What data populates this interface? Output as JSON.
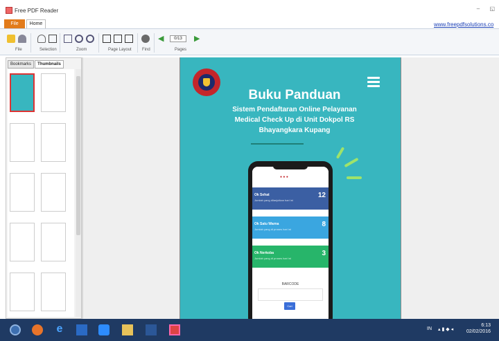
{
  "app": {
    "title": "Free PDF Reader",
    "link": "www.freepdfsolutions.co"
  },
  "ribbon": {
    "tabs": [
      {
        "label": "File"
      },
      {
        "label": "Home"
      }
    ],
    "groups": [
      "File",
      "Selection",
      "Zoom",
      "Page Layout",
      "Find",
      "Pages"
    ],
    "page_indicator": "0/13"
  },
  "sidebar": {
    "tabs": [
      {
        "label": "Bookmarks"
      },
      {
        "label": "Thumbnails"
      }
    ]
  },
  "document": {
    "title": "Buku Panduan",
    "subtitle_lines": [
      "Sistem Pendaftaran Online Pelayanan",
      "Medical Check Up di Unit Dokpol RS",
      "Bhayangkara Kupang"
    ],
    "phone": {
      "cards": [
        {
          "title": "Ok Sehat",
          "sub": "Jumlah yang dilanjutkan hari ini",
          "num": "12",
          "color": "#3b5fa3"
        },
        {
          "title": "Ok Satu Warna",
          "sub": "Jumlah yang di proses hari ini",
          "num": "8",
          "color": "#3aa6e0"
        },
        {
          "title": "Ok Nerkoba",
          "sub": "Jumlah yang di proses hari ini",
          "num": "3",
          "color": "#27b56a"
        }
      ],
      "barcode_label": "BARCODE",
      "button": "Cari"
    }
  },
  "taskbar": {
    "lang": "IN",
    "time": "6:13",
    "date": "02/02/2016"
  }
}
